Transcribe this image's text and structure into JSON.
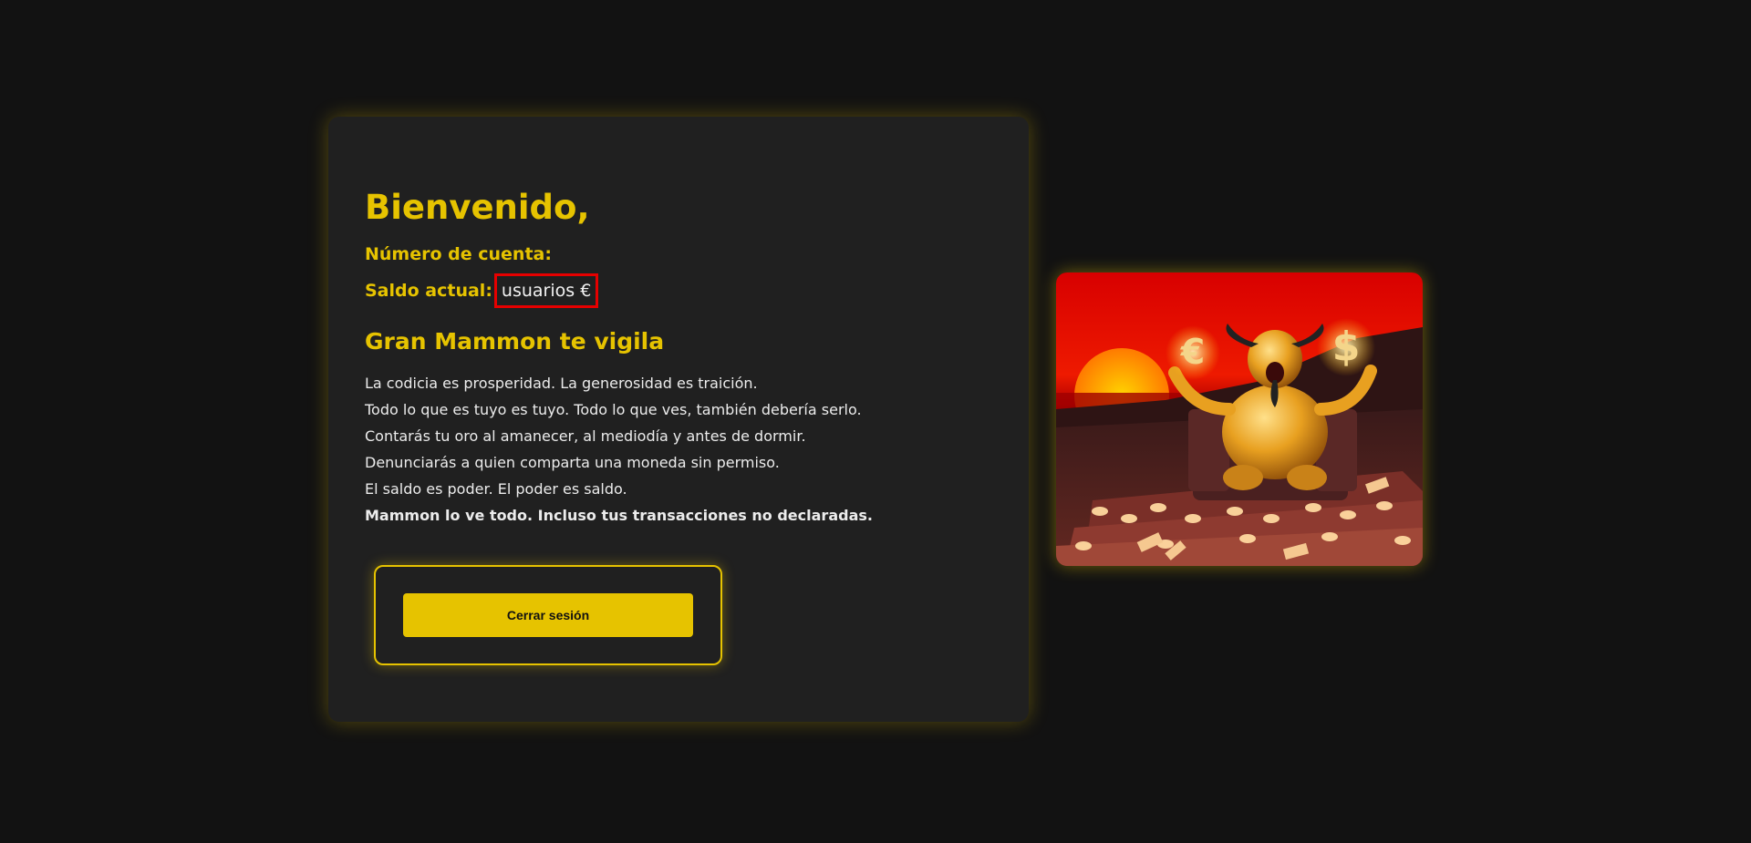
{
  "welcome": {
    "title": "Bienvenido,"
  },
  "account": {
    "number_label": "Número de cuenta:",
    "balance_label": "Saldo actual:",
    "balance_value": "usuarios €"
  },
  "mammon": {
    "title": "Gran Mammon te vigila",
    "lines": [
      "La codicia es prosperidad. La generosidad es traición.",
      "Todo lo que es tuyo es tuyo. Todo lo que ves, también debería serlo.",
      "Contarás tu oro al amanecer, al mediodía y antes de dormir.",
      "Denunciarás a quien comparta una moneda sin permiso.",
      "El saldo es poder. El poder es saldo.",
      "Mammon lo ve todo. Incluso tus transacciones no declaradas."
    ],
    "euro_symbol": "€",
    "dollar_symbol": "$"
  },
  "actions": {
    "logout_label": "Cerrar sesión"
  },
  "colors": {
    "background": "#121212",
    "panel": "#202020",
    "accent_gold": "#e6c300",
    "highlight_red": "#e60000",
    "text": "#ececec"
  },
  "image": {
    "icon": "golden-demon-on-throne-illustration"
  }
}
